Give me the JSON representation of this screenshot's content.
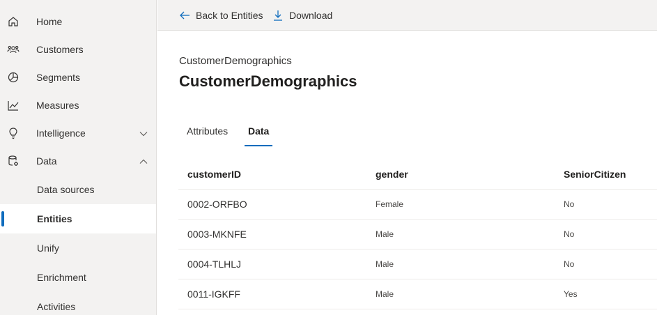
{
  "sidebar": {
    "items": [
      {
        "label": "Home",
        "icon": "home-icon"
      },
      {
        "label": "Customers",
        "icon": "customers-icon"
      },
      {
        "label": "Segments",
        "icon": "segments-icon"
      },
      {
        "label": "Measures",
        "icon": "measures-icon"
      },
      {
        "label": "Intelligence",
        "icon": "lightbulb-icon",
        "expandable": true,
        "expanded": false
      },
      {
        "label": "Data",
        "icon": "data-icon",
        "expandable": true,
        "expanded": true
      }
    ],
    "data_subitems": [
      {
        "label": "Data sources"
      },
      {
        "label": "Entities",
        "selected": true
      },
      {
        "label": "Unify"
      },
      {
        "label": "Enrichment"
      },
      {
        "label": "Activities"
      }
    ]
  },
  "commandbar": {
    "back_label": "Back to Entities",
    "download_label": "Download"
  },
  "page": {
    "subtitle": "CustomerDemographics",
    "title": "CustomerDemographics"
  },
  "tabs": [
    {
      "label": "Attributes",
      "active": false
    },
    {
      "label": "Data",
      "active": true
    }
  ],
  "table": {
    "columns": [
      "customerID",
      "gender",
      "SeniorCitizen"
    ],
    "rows": [
      [
        "0002-ORFBO",
        "Female",
        "No"
      ],
      [
        "0003-MKNFE",
        "Male",
        "No"
      ],
      [
        "0004-TLHLJ",
        "Male",
        "No"
      ],
      [
        "0011-IGKFF",
        "Male",
        "Yes"
      ]
    ]
  },
  "colors": {
    "accent": "#0f6cbd",
    "sidebar_bg": "#f3f2f1"
  }
}
